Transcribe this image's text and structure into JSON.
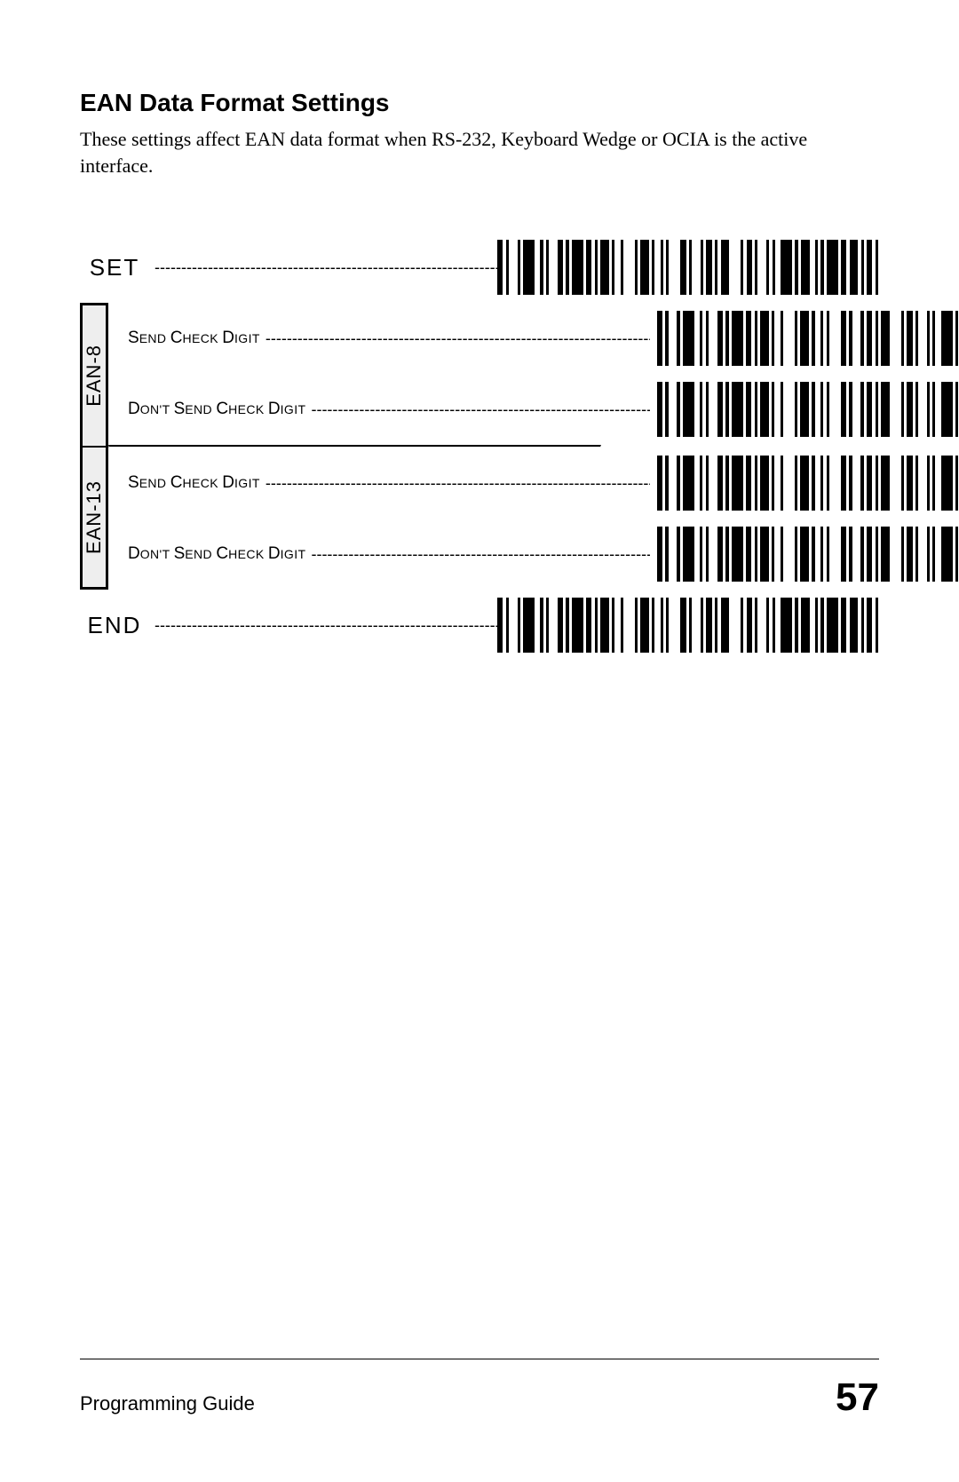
{
  "title": "EAN Data Format Settings",
  "intro": "These settings affect EAN data format when RS-232, Keyboard Wedge or OCIA is the active interface.",
  "markers": {
    "set": "SET",
    "end": "END"
  },
  "groups": [
    {
      "name": "EAN-8",
      "options": [
        {
          "label_caps": [
            "S",
            "C",
            "D"
          ],
          "label_rest": [
            "END ",
            "HECK ",
            "IGIT"
          ],
          "full": "Send Check Digit"
        },
        {
          "label_caps": [
            "D",
            "S",
            "C",
            "D"
          ],
          "label_rest": [
            "ON'T ",
            "END ",
            "HECK ",
            "IGIT"
          ],
          "full": "Don't Send Check Digit"
        }
      ]
    },
    {
      "name": "EAN-13",
      "options": [
        {
          "label_caps": [
            "S",
            "C",
            "D"
          ],
          "label_rest": [
            "END ",
            "HECK ",
            "IGIT"
          ],
          "full": "Send Check Digit"
        },
        {
          "label_caps": [
            "D",
            "S",
            "C",
            "D"
          ],
          "label_rest": [
            "ON'T ",
            "END ",
            "HECK ",
            "IGIT"
          ],
          "full": "Don't Send Check Digit"
        }
      ]
    }
  ],
  "footer": {
    "guide": "Programming Guide",
    "page": "57"
  },
  "barcode_patterns": {
    "wide": [
      2,
      1,
      1,
      3,
      1,
      1,
      4,
      2,
      1,
      1,
      1,
      3,
      2,
      1,
      1,
      1,
      4,
      1,
      2,
      1,
      1,
      1,
      3,
      1,
      1,
      2,
      1,
      4,
      1,
      1,
      3,
      1,
      1,
      2,
      1,
      1,
      1,
      4,
      2,
      1,
      1,
      3,
      1,
      1,
      2,
      1,
      1,
      1,
      3,
      4,
      1,
      1,
      2,
      1,
      1,
      3,
      1,
      1,
      1,
      2,
      4,
      1,
      1,
      1,
      3,
      2,
      1,
      1,
      1,
      1,
      4,
      1,
      2,
      1,
      3,
      1,
      1,
      1,
      2,
      1,
      1
    ],
    "mid": [
      2,
      1,
      1,
      3,
      1,
      1,
      4,
      2,
      1,
      1,
      1,
      3,
      2,
      1,
      1,
      1,
      4,
      1,
      2,
      1,
      1,
      1,
      3,
      1,
      1,
      2,
      1,
      4,
      1,
      1,
      3,
      1,
      1,
      2,
      1,
      1,
      1,
      4,
      2,
      1,
      1,
      3,
      1,
      1,
      2,
      1,
      1,
      1,
      3,
      4,
      1,
      1,
      2,
      1,
      1,
      3,
      1,
      1,
      1,
      2,
      4,
      1,
      1
    ]
  }
}
